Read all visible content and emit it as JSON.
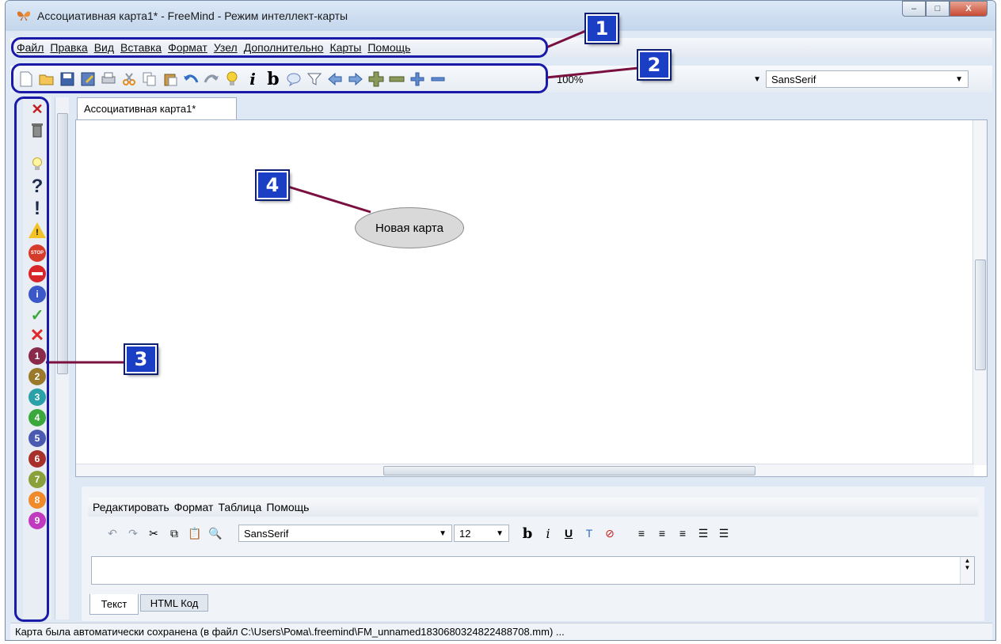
{
  "window": {
    "title": "Ассоциативная карта1* - FreeMind - Режим интеллект-карты",
    "minimize": "–",
    "maximize": "□",
    "close": "X"
  },
  "menubar": [
    "Файл",
    "Правка",
    "Вид",
    "Вставка",
    "Формат",
    "Узел",
    "Дополнительно",
    "Карты",
    "Помощь"
  ],
  "toolbar": {
    "icons": [
      "new-icon",
      "open-icon",
      "save-icon",
      "save-as-icon",
      "print-icon",
      "cut-icon",
      "copy-icon",
      "paste-icon",
      "undo-icon",
      "redo-icon",
      "idea-icon",
      "italic-icon",
      "bold-icon",
      "cloud-icon",
      "filter-icon",
      "back-icon",
      "forward-icon",
      "plus-big-icon",
      "minus-big-icon",
      "plus-icon",
      "minus-icon"
    ],
    "italic_label": "i",
    "bold_label": "b",
    "zoom_value": "100%",
    "font_value": "SansSerif"
  },
  "tab": {
    "label": "Ассоциативная карта1*"
  },
  "map": {
    "root_node": "Новая карта"
  },
  "left_icons": [
    "remove-icon",
    "trash-icon",
    "bulb-icon",
    "question-icon",
    "exclamation-icon",
    "warning-icon",
    "stop-icon",
    "no-entry-icon",
    "info-icon",
    "check-icon",
    "cross-icon",
    "priority-1-icon",
    "priority-2-icon",
    "priority-3-icon",
    "priority-4-icon",
    "priority-5-icon",
    "priority-6-icon",
    "priority-7-icon",
    "priority-8-icon",
    "priority-9-icon"
  ],
  "left_glyphs": {
    "question": "?",
    "exclamation": "!",
    "warning": "!",
    "stop": "STOP",
    "info": "i",
    "check": "✓",
    "cross": "✕",
    "numbers": [
      "1",
      "2",
      "3",
      "4",
      "5",
      "6",
      "7",
      "8",
      "9"
    ]
  },
  "editor": {
    "menu": [
      "Редактировать",
      "Формат",
      "Таблица",
      "Помощь"
    ],
    "font_value": "SansSerif",
    "size_value": "12",
    "tabs": [
      "Текст",
      "HTML Код"
    ],
    "bold_label": "b",
    "italic_label": "i",
    "underline_label": "U"
  },
  "statusbar": {
    "text": "Карта была автоматически сохранена (в файл C:\\Users\\Рома\\.freemind\\FM_unnamed1830680324822488708.mm) ..."
  },
  "callouts": [
    "1",
    "2",
    "3",
    "4"
  ],
  "colors": {
    "callout_blue": "#1b3fc4",
    "leader_line": "#7a1040",
    "node_fill": "#d9d9d9"
  }
}
